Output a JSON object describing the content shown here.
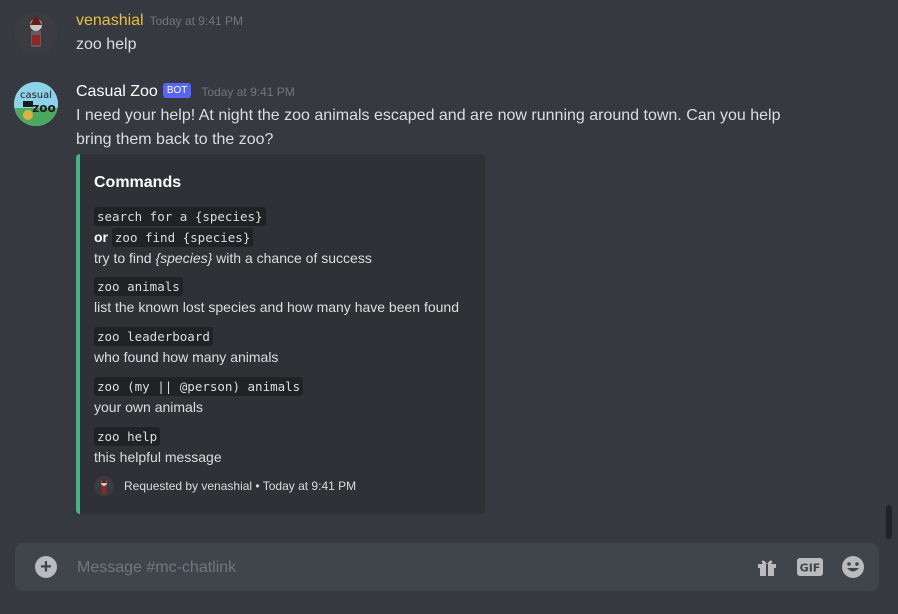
{
  "messages": [
    {
      "author": "venashial",
      "author_color": "#e5c041",
      "timestamp": "Today at 9:41 PM",
      "content": "zoo help"
    },
    {
      "author": "Casual Zoo",
      "author_color": "#ffffff",
      "badge": "BOT",
      "timestamp": "Today at 9:41 PM",
      "content_line1": "I need your help! At night the zoo animals escaped and are now running around town. Can you help",
      "content_line2": "bring them back to the zoo?",
      "avatar_text_1": "casual",
      "avatar_text_2": "zoo",
      "embed": {
        "title": "Commands",
        "accent": "#43b581",
        "fields": [
          {
            "code1": "search for a {species}",
            "or": "or",
            "code2": "zoo find {species}",
            "desc_prefix": "try to find ",
            "desc_em": "{species}",
            "desc_suffix": " with a chance of success"
          },
          {
            "code": "zoo animals",
            "desc": "list the known lost species and how many have been found"
          },
          {
            "code": "zoo leaderboard",
            "desc": "who found how many animals"
          },
          {
            "code": "zoo (my || @person) animals",
            "desc": "your own animals"
          },
          {
            "code": "zoo help",
            "desc": "this helpful message"
          }
        ],
        "footer": "Requested by venashial • Today at 9:41 PM"
      }
    }
  ],
  "composer": {
    "placeholder": "Message #mc-chatlink",
    "gif_label": "GIF"
  },
  "icons": [
    "plus-circle-icon",
    "gift-icon",
    "gif-icon",
    "emoji-icon"
  ],
  "colors": {
    "background": "#36393f",
    "embed_background": "#2f3136",
    "composer_background": "#40444b",
    "bot_badge": "#5865f2"
  }
}
